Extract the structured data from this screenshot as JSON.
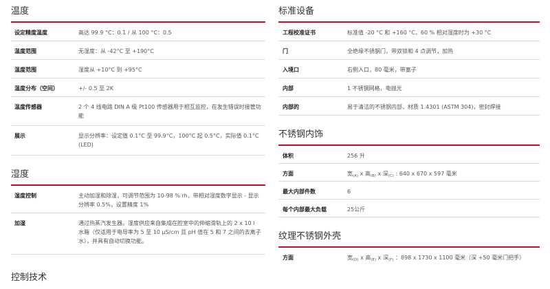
{
  "left": {
    "temp": {
      "title": "温度",
      "rows": [
        {
          "k": "设定精度温度",
          "v": "高达 99.9 °C：0.1 / 从 100 °C：0.5"
        },
        {
          "k": "温度范围",
          "v": "无湿度：从 -42°C 至 +190°C"
        },
        {
          "k": "温度范围",
          "v": "湿度从 +10°C 到 +95°C"
        },
        {
          "k": "温度分布（空间）",
          "v": "+/- 0.5 至 2K"
        },
        {
          "k": "温度传感器",
          "v": "2 个 4 线电路 DIN A 级 Pt100 传感器用于相互监控，在发生错误时接管功能"
        },
        {
          "k": "展示",
          "v": "显示分辨率：设定值 0.1°C 至 99.9°C，100°C 起 0.5°C，实际值 0.1°C (LED)"
        }
      ]
    },
    "humidity": {
      "title": "湿度",
      "rows": [
        {
          "k": "湿度控制",
          "v": "主动加湿和除湿，可调节范围为 10-98 % rh，带相对湿度数字显示 - 显示分辨率 0.5%，设置精度 1%"
        },
        {
          "k": "加湿",
          "v": "通过热蒸汽发生器。湿度供应来自集成在腔室中的伸缩滑轨上的 2 x 10 l 水箱（仅适用于电导率为 5 至 10 µS/cm 且 pH 值在 5 和 7 之间的去离子水），并具有自动切换功能。"
        }
      ]
    },
    "control": {
      "title": "控制技术"
    }
  },
  "right": {
    "standard": {
      "title": "标准设备",
      "rows": [
        {
          "k": "工程校准证书",
          "v": "标准值 -20 °C 和 +160 °C，60 % 相对湿度时为 +30 °C"
        },
        {
          "k": "门",
          "v": "全绝缘不锈钢门，带双锁和 4 点调节，加热"
        },
        {
          "k": "入境口",
          "v": "右侧入口，80 毫米，带塞子"
        },
        {
          "k": "内部",
          "v": "1 不锈钢网格，电抛光"
        },
        {
          "k": "内部的",
          "v": "易于清洁的不锈钢内部，材质 1.4301 (ASTM 304)，密封焊接"
        }
      ]
    },
    "interior": {
      "title": "不锈钢内饰",
      "rows": [
        {
          "k": "体积",
          "v": "256 升"
        },
        {
          "k": "方面",
          "v_html": true
        },
        {
          "k": "最大内部件数",
          "v": "6"
        },
        {
          "k": "每个内部最大负载",
          "v": "25公斤"
        }
      ],
      "dims": {
        "w": "宽",
        "w_sub": "(A)",
        "h": "高",
        "h_sub": "(B)",
        "d": "深",
        "d_sub": "(C)",
        "value": ": 640 x 670 x 597 毫米"
      }
    },
    "housing": {
      "title": "纹理不锈钢外壳",
      "rows": [
        {
          "k": "方面",
          "v_html": true
        }
      ],
      "dims": {
        "w": "宽",
        "w_sub": "(D)",
        "h": "高",
        "h_sub": "(E)",
        "d": "深",
        "d_sub": "(F)",
        "value": "：898 x 1730 x 1100 毫米（深 +50 毫米门把手）"
      }
    }
  }
}
